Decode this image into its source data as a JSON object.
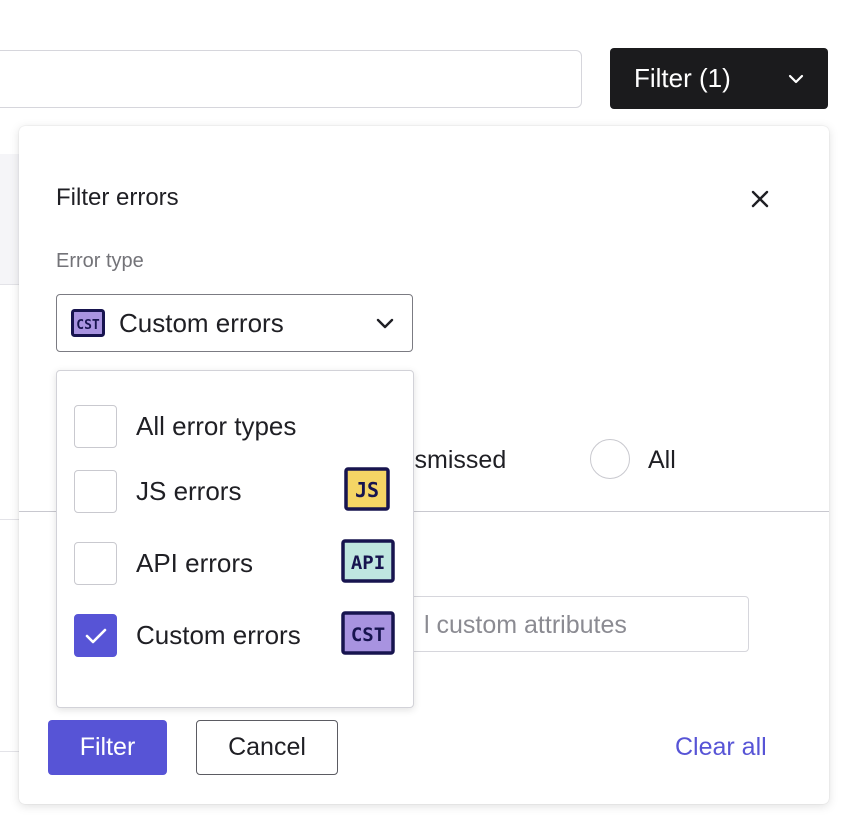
{
  "toolbar": {
    "filter_button_label": "Filter (1)"
  },
  "panel": {
    "title": "Filter errors",
    "error_type_label": "Error type",
    "select": {
      "selected_label": "Custom errors",
      "selected_badge_text": "CST"
    },
    "options": [
      {
        "label": "All error types",
        "checked": false,
        "badge_text": ""
      },
      {
        "label": "JS errors",
        "checked": false,
        "badge_text": "JS"
      },
      {
        "label": "API errors",
        "checked": false,
        "badge_text": "API"
      },
      {
        "label": "Custom errors",
        "checked": true,
        "badge_text": "CST"
      }
    ],
    "status_partial": "ismissed",
    "status_all_label": "All",
    "attributes_placeholder_partial": "l custom attributes",
    "actions": {
      "filter_label": "Filter",
      "cancel_label": "Cancel",
      "clear_all_label": "Clear all"
    }
  },
  "colors": {
    "accent": "#5754d6",
    "dark_button": "#1b1b1d",
    "js_badge": "#f5d565",
    "api_badge": "#bfe6e0",
    "cst_badge": "#a893e0",
    "badge_ink": "#17144f"
  },
  "icons": {
    "close": "close-icon",
    "chevron": "chevron-down-icon",
    "check": "check-icon"
  }
}
